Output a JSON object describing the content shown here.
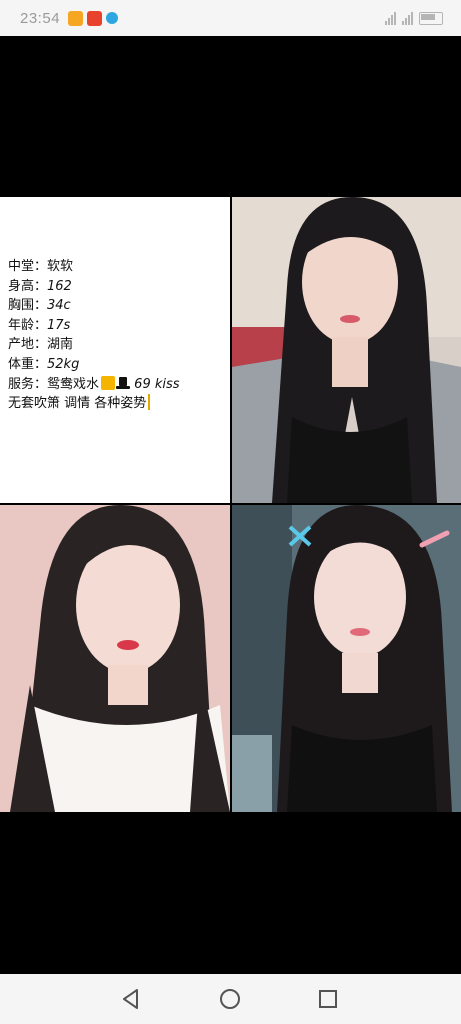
{
  "status_bar": {
    "time": "23:54",
    "notification_icons": [
      "app-icon-orange",
      "app-icon-red",
      "app-icon-blue"
    ],
    "right_icons": [
      "signal-icon",
      "signal-icon",
      "battery-icon"
    ]
  },
  "post": {
    "lines": [
      {
        "label": "中堂：",
        "value": "软软"
      },
      {
        "label": "身高：",
        "value": "162"
      },
      {
        "label": "胸围：",
        "value": "34c"
      },
      {
        "label": "年龄：",
        "value": "17s"
      },
      {
        "label": "产地：",
        "value": "湖南"
      },
      {
        "label": "体重：",
        "value": "52kg"
      }
    ],
    "service_label": "服务：",
    "service_value": "鸳鸯戏水",
    "service_emojis": [
      "无-emoji",
      "top-hat-emoji"
    ],
    "service_extra": "69 kiss",
    "last_line": "无套吹箫 调情 各种姿势"
  },
  "photos": [
    "portrait-photo-1",
    "portrait-photo-2",
    "portrait-photo-3"
  ],
  "nav_bar": {
    "icons": [
      "back-icon",
      "home-icon",
      "recents-icon"
    ]
  },
  "colors": {
    "status_bg": "#f5f5f5",
    "text": "#111111",
    "caret": "#e2a900",
    "emoji_yellow": "#f5b400"
  }
}
